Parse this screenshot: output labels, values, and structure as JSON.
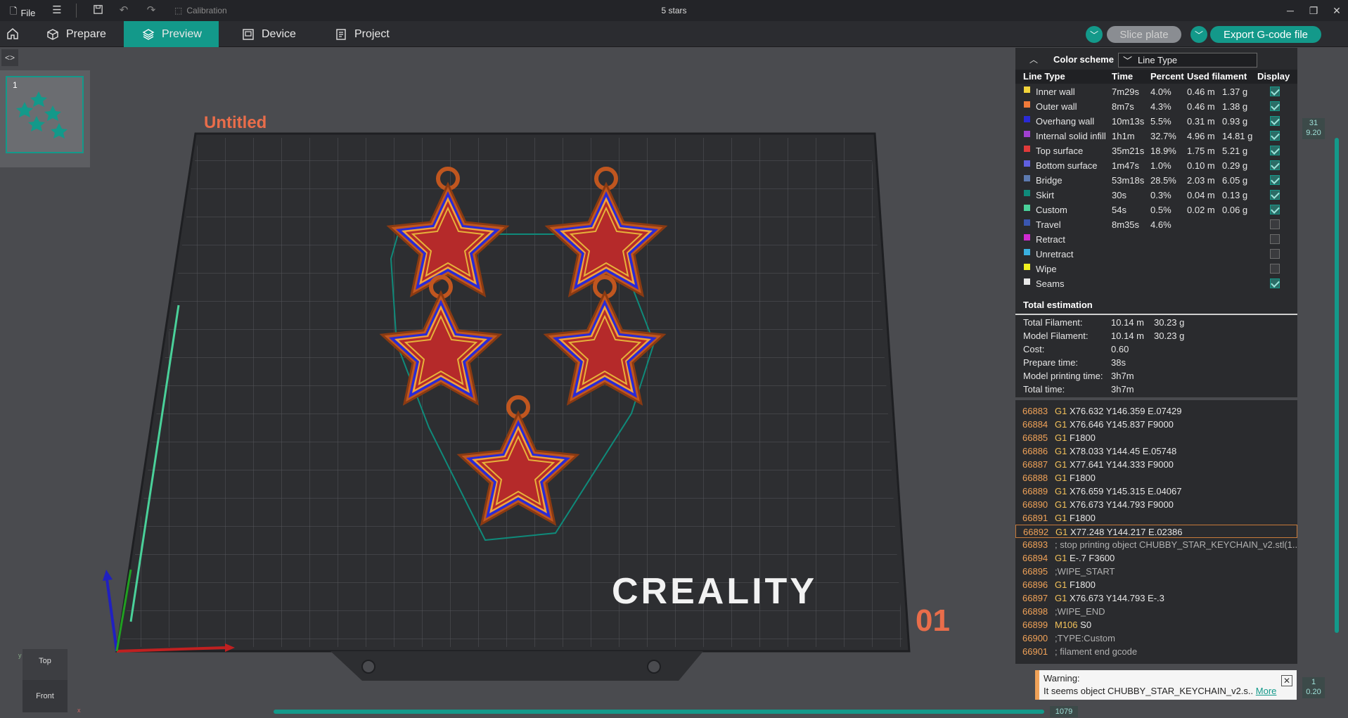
{
  "titlebar": {
    "file_label": "File",
    "calibration_label": "Calibration",
    "project_title": "5 stars"
  },
  "nav": {
    "tabs": [
      {
        "label": "Prepare"
      },
      {
        "label": "Preview"
      },
      {
        "label": "Device"
      },
      {
        "label": "Project"
      }
    ],
    "slice_label": "Slice plate",
    "export_label": "Export G-code file"
  },
  "plate": {
    "number": "1",
    "name": "Untitled",
    "brand": "CREALITY",
    "plate_index": "01"
  },
  "legend": {
    "color_scheme_label": "Color scheme",
    "color_scheme_value": "Line Type",
    "headers": [
      "Line Type",
      "Time",
      "Percent",
      "Used filament",
      "Display"
    ],
    "rows": [
      {
        "name": "Inner wall",
        "color": "#f2d43a",
        "time": "7m29s",
        "percent": "4.0%",
        "len": "0.46 m",
        "weight": "1.37 g",
        "display": true
      },
      {
        "name": "Outer wall",
        "color": "#f07a3a",
        "time": "8m7s",
        "percent": "4.3%",
        "len": "0.46 m",
        "weight": "1.38 g",
        "display": true
      },
      {
        "name": "Overhang wall",
        "color": "#2a2ad6",
        "time": "10m13s",
        "percent": "5.5%",
        "len": "0.31 m",
        "weight": "0.93 g",
        "display": true
      },
      {
        "name": "Internal solid infill",
        "color": "#a040d0",
        "time": "1h1m",
        "percent": "32.7%",
        "len": "4.96 m",
        "weight": "14.81 g",
        "display": true
      },
      {
        "name": "Top surface",
        "color": "#e03a3a",
        "time": "35m21s",
        "percent": "18.9%",
        "len": "1.75 m",
        "weight": "5.21 g",
        "display": true
      },
      {
        "name": "Bottom surface",
        "color": "#6060e0",
        "time": "1m47s",
        "percent": "1.0%",
        "len": "0.10 m",
        "weight": "0.29 g",
        "display": true
      },
      {
        "name": "Bridge",
        "color": "#5c7ab0",
        "time": "53m18s",
        "percent": "28.5%",
        "len": "2.03 m",
        "weight": "6.05 g",
        "display": true
      },
      {
        "name": "Skirt",
        "color": "#0f8a7a",
        "time": "30s",
        "percent": "0.3%",
        "len": "0.04 m",
        "weight": "0.13 g",
        "display": true
      },
      {
        "name": "Custom",
        "color": "#4ad19a",
        "time": "54s",
        "percent": "0.5%",
        "len": "0.02 m",
        "weight": "0.06 g",
        "display": true
      },
      {
        "name": "Travel",
        "color": "#3a56b0",
        "time": "8m35s",
        "percent": "4.6%",
        "len": "",
        "weight": "",
        "display": false
      },
      {
        "name": "Retract",
        "color": "#d02ad0",
        "time": "",
        "percent": "",
        "len": "",
        "weight": "",
        "display": false
      },
      {
        "name": "Unretract",
        "color": "#3ab0e0",
        "time": "",
        "percent": "",
        "len": "",
        "weight": "",
        "display": false
      },
      {
        "name": "Wipe",
        "color": "#f0f020",
        "time": "",
        "percent": "",
        "len": "",
        "weight": "",
        "display": false
      },
      {
        "name": "Seams",
        "color": "#e8e8e8",
        "time": "",
        "percent": "",
        "len": "",
        "weight": "",
        "display": true
      }
    ]
  },
  "totals": {
    "title": "Total estimation",
    "rows": [
      {
        "label": "Total Filament:",
        "v1": "10.14 m",
        "v2": "30.23 g"
      },
      {
        "label": "Model Filament:",
        "v1": "10.14 m",
        "v2": "30.23 g"
      },
      {
        "label": "Cost:",
        "v1": "0.60",
        "v2": ""
      },
      {
        "label": "Prepare time:",
        "v1": "38s",
        "v2": ""
      },
      {
        "label": "Model printing time:",
        "v1": "3h7m",
        "v2": ""
      },
      {
        "label": "Total time:",
        "v1": "3h7m",
        "v2": ""
      }
    ]
  },
  "gcode": {
    "lines": [
      {
        "n": "66883",
        "op": "G1",
        "rest": " X76.632 Y146.359 E.07429",
        "comment": false,
        "selected": false
      },
      {
        "n": "66884",
        "op": "G1",
        "rest": " X76.646 Y145.837 F9000",
        "comment": false,
        "selected": false
      },
      {
        "n": "66885",
        "op": "G1",
        "rest": " F1800",
        "comment": false,
        "selected": false
      },
      {
        "n": "66886",
        "op": "G1",
        "rest": " X78.033 Y144.45 E.05748",
        "comment": false,
        "selected": false
      },
      {
        "n": "66887",
        "op": "G1",
        "rest": " X77.641 Y144.333 F9000",
        "comment": false,
        "selected": false
      },
      {
        "n": "66888",
        "op": "G1",
        "rest": " F1800",
        "comment": false,
        "selected": false
      },
      {
        "n": "66889",
        "op": "G1",
        "rest": " X76.659 Y145.315 E.04067",
        "comment": false,
        "selected": false
      },
      {
        "n": "66890",
        "op": "G1",
        "rest": " X76.673 Y144.793 F9000",
        "comment": false,
        "selected": false
      },
      {
        "n": "66891",
        "op": "G1",
        "rest": " F1800",
        "comment": false,
        "selected": false
      },
      {
        "n": "66892",
        "op": "G1",
        "rest": " X77.248 Y144.217 E.02386",
        "comment": false,
        "selected": true
      },
      {
        "n": "66893",
        "op": "",
        "rest": "; stop printing object CHUBBY_STAR_KEYCHAIN_v2.stl(1...",
        "comment": true,
        "selected": false
      },
      {
        "n": "66894",
        "op": "G1",
        "rest": " E-.7 F3600",
        "comment": false,
        "selected": false
      },
      {
        "n": "66895",
        "op": "",
        "rest": ";WIPE_START",
        "comment": true,
        "selected": false
      },
      {
        "n": "66896",
        "op": "G1",
        "rest": " F1800",
        "comment": false,
        "selected": false
      },
      {
        "n": "66897",
        "op": "G1",
        "rest": " X76.673 Y144.793 E-.3",
        "comment": false,
        "selected": false
      },
      {
        "n": "66898",
        "op": "",
        "rest": ";WIPE_END",
        "comment": true,
        "selected": false
      },
      {
        "n": "66899",
        "op": "M106",
        "rest": " S0",
        "comment": false,
        "selected": false
      },
      {
        "n": "66900",
        "op": "",
        "rest": ";TYPE:Custom",
        "comment": true,
        "selected": false
      },
      {
        "n": "66901",
        "op": "",
        "rest": "; filament end gcode",
        "comment": true,
        "selected": false
      }
    ]
  },
  "warning": {
    "title": "Warning:",
    "message": "It seems object CHUBBY_STAR_KEYCHAIN_v2.s..",
    "more": "More"
  },
  "layer_slider": {
    "top_layer": "31",
    "top_height": "9.20",
    "bottom_layer": "1",
    "bottom_height": "0.20"
  },
  "move_slider": {
    "value": "1079"
  },
  "view_cube": {
    "top": "Top",
    "front": "Front",
    "axis_x": "x",
    "axis_y": "y"
  }
}
